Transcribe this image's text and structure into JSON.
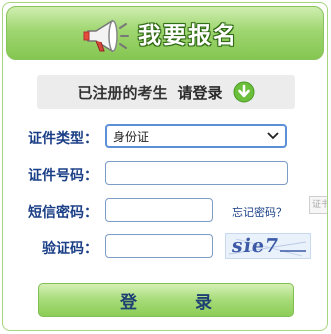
{
  "banner": {
    "title": "我要报名"
  },
  "registered": {
    "text": "已注册的考生",
    "link": "请登录"
  },
  "form": {
    "id_type": {
      "label": "证件类型：",
      "value": "身份证"
    },
    "id_number": {
      "label": "证件号码：",
      "value": ""
    },
    "sms_password": {
      "label": "短信密码：",
      "value": ""
    },
    "forgot_password": "忘记密码？",
    "captcha": {
      "label": "验证码：",
      "value": "",
      "image_text": "sie7"
    },
    "side_tag": "证书"
  },
  "login": {
    "label": "登 录"
  },
  "colors": {
    "green": "#8ccd57",
    "label_blue": "#1b3f86",
    "accent_blue": "#5b8fd6"
  },
  "icons": [
    "megaphone-icon",
    "down-arrow-icon",
    "chevron-down-icon"
  ]
}
